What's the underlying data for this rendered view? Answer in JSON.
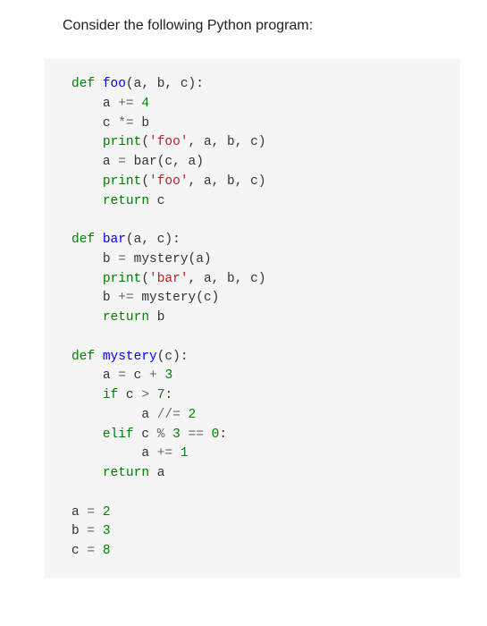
{
  "prompt": "Consider the following Python program:",
  "code": {
    "l1_def": "def",
    "l1_fn": "foo",
    "l1_rest": "(a, b, c):",
    "l2_a": "a",
    "l2_op": "+=",
    "l2_n": "4",
    "l3_c": "c",
    "l3_op": "*=",
    "l3_b": "b",
    "l4_print": "print",
    "l4_open": "(",
    "l4_str": "'foo'",
    "l4_rest": ", a, b, c)",
    "l5_a": "a",
    "l5_eq": "=",
    "l5_bar": "bar(c, a)",
    "l6_print": "print",
    "l6_open": "(",
    "l6_str": "'foo'",
    "l6_rest": ", a, b, c)",
    "l7_ret": "return",
    "l7_c": " c",
    "l8_def": "def",
    "l8_fn": "bar",
    "l8_rest": "(a, c):",
    "l9_b": "b",
    "l9_eq": "=",
    "l9_rest": " mystery(a)",
    "l10_print": "print",
    "l10_open": "(",
    "l10_str": "'bar'",
    "l10_rest": ", a, b, c)",
    "l11_b": "b",
    "l11_op": "+=",
    "l11_rest": " mystery(c)",
    "l12_ret": "return",
    "l12_b": " b",
    "l13_def": "def",
    "l13_fn": "mystery",
    "l13_rest": "(c):",
    "l14_a": "a",
    "l14_eq": "=",
    "l14_c": " c",
    "l14_plus": "+",
    "l14_n": "3",
    "l15_if": "if",
    "l15_c": " c",
    "l15_gt": " >",
    "l15_n": "7",
    "l15_colon": ":",
    "l16_a": "a",
    "l16_op": "//=",
    "l16_n": "2",
    "l17_elif": "elif",
    "l17_c": " c",
    "l17_mod": " %",
    "l17_n1": "3",
    "l17_eq": " ==",
    "l17_n2": "0",
    "l17_colon": ":",
    "l18_a": "a",
    "l18_op": "+=",
    "l18_n": "1",
    "l19_ret": "return",
    "l19_a": " a",
    "l20_a": "a",
    "l20_eq": "=",
    "l20_n": "2",
    "l21_b": "b",
    "l21_eq": "=",
    "l21_n": "3",
    "l22_c": "c",
    "l22_eq": "=",
    "l22_n": "8"
  }
}
